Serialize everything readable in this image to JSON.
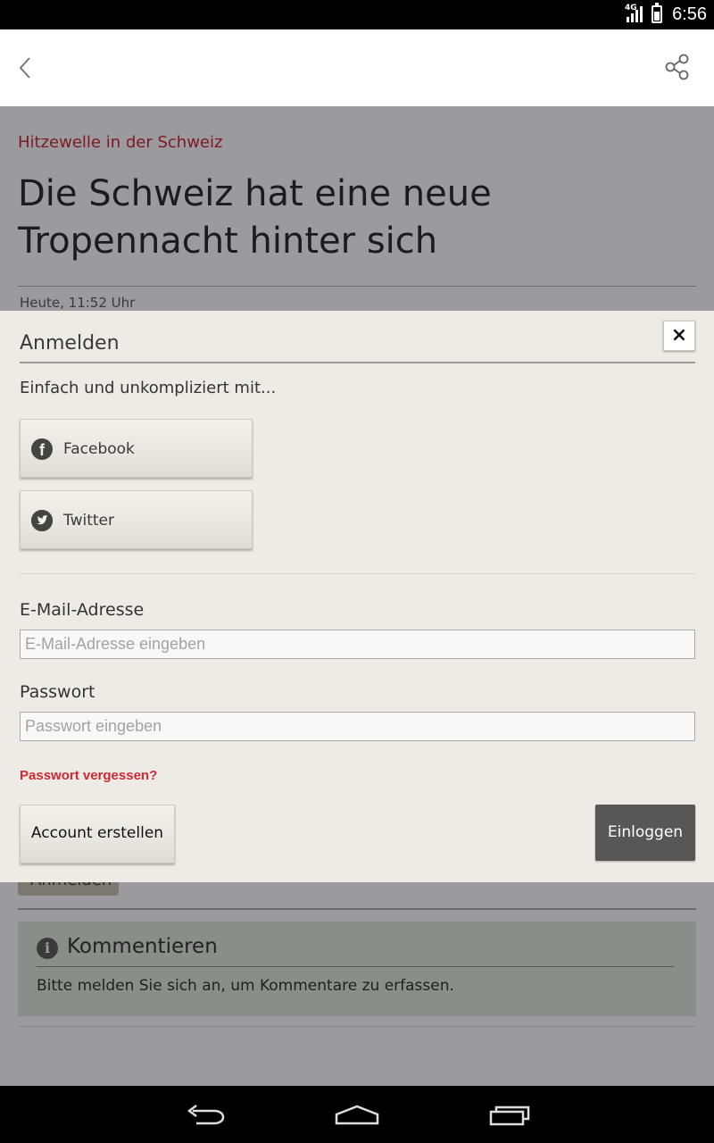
{
  "status_bar": {
    "network": "4G",
    "time": "6:56"
  },
  "article": {
    "kicker": "Hitzewelle in der Schweiz",
    "headline": "Die Schweiz hat eine neue Tropennacht hinter sich",
    "date": "Heute, 11:52 Uhr",
    "underlying_button": "Anmelden",
    "comments": {
      "title": "Kommentieren",
      "text": "Bitte melden Sie sich an, um Kommentare zu erfassen."
    }
  },
  "login": {
    "title": "Anmelden",
    "close_label": "×",
    "subtitle": "Einfach und unkompliziert mit...",
    "social": [
      {
        "label": "Facebook",
        "icon": "facebook-icon",
        "glyph": "f"
      },
      {
        "label": "Twitter",
        "icon": "twitter-icon",
        "glyph": "🐦"
      }
    ],
    "email_label": "E-Mail-Adresse",
    "email_placeholder": "E-Mail-Adresse eingeben",
    "email_value": "",
    "password_label": "Passwort",
    "password_placeholder": "Passwort eingeben",
    "password_value": "",
    "forgot_label": "Passwort vergessen?",
    "create_account_label": "Account erstellen",
    "login_label": "Einloggen"
  },
  "colors": {
    "accent_red": "#d02830",
    "kicker_red": "#7e1a1f",
    "login_button": "#575757",
    "dialog_bg": "#eeebe6"
  }
}
